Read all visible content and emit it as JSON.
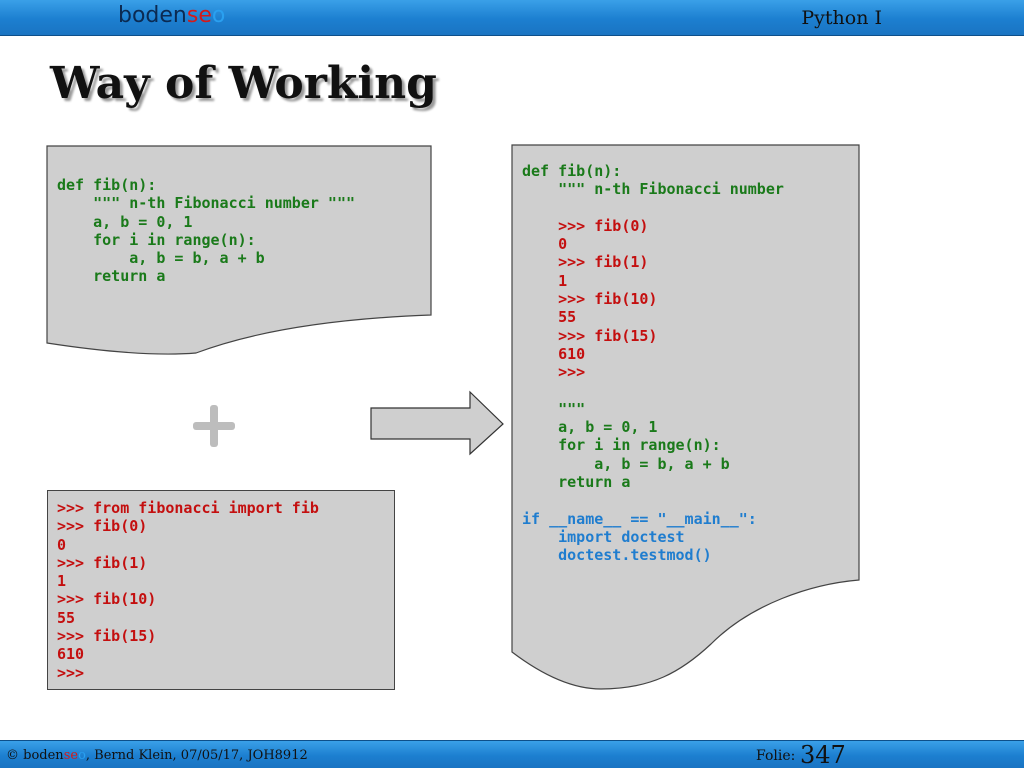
{
  "header": {
    "logo_prefix": "boden",
    "logo_mid": "se",
    "logo_suffix": "o",
    "course": "Python I"
  },
  "title": "Way of Working",
  "left_top_code": [
    {
      "text": "def fib(n):",
      "color": "green"
    },
    {
      "text": "    \"\"\" n-th Fibonacci number \"\"\"",
      "color": "green"
    },
    {
      "text": "    a, b = 0, 1",
      "color": "green"
    },
    {
      "text": "    for i in range(n):",
      "color": "green"
    },
    {
      "text": "        a, b = b, a + b",
      "color": "green"
    },
    {
      "text": "    return a",
      "color": "green"
    }
  ],
  "left_bottom_code": [
    {
      "text": ">>> from fibonacci import fib",
      "color": "red"
    },
    {
      "text": ">>> fib(0)",
      "color": "red"
    },
    {
      "text": "0",
      "color": "red"
    },
    {
      "text": ">>> fib(1)",
      "color": "red"
    },
    {
      "text": "1",
      "color": "red"
    },
    {
      "text": ">>> fib(10)",
      "color": "red"
    },
    {
      "text": "55",
      "color": "red"
    },
    {
      "text": ">>> fib(15)",
      "color": "red"
    },
    {
      "text": "610",
      "color": "red"
    },
    {
      "text": ">>>",
      "color": "red"
    }
  ],
  "right_code": [
    {
      "text": "def fib(n):",
      "color": "green"
    },
    {
      "text": "    \"\"\" n-th Fibonacci number",
      "color": "green"
    },
    {
      "text": "",
      "color": "green"
    },
    {
      "text": "    >>> fib(0)",
      "color": "red"
    },
    {
      "text": "    0",
      "color": "red"
    },
    {
      "text": "    >>> fib(1)",
      "color": "red"
    },
    {
      "text": "    1",
      "color": "red"
    },
    {
      "text": "    >>> fib(10)",
      "color": "red"
    },
    {
      "text": "    55",
      "color": "red"
    },
    {
      "text": "    >>> fib(15)",
      "color": "red"
    },
    {
      "text": "    610",
      "color": "red"
    },
    {
      "text": "    >>>",
      "color": "red"
    },
    {
      "text": "",
      "color": "green"
    },
    {
      "text": "    \"\"\"",
      "color": "green"
    },
    {
      "text": "    a, b = 0, 1",
      "color": "green"
    },
    {
      "text": "    for i in range(n):",
      "color": "green"
    },
    {
      "text": "        a, b = b, a + b",
      "color": "green"
    },
    {
      "text": "    return a",
      "color": "green"
    },
    {
      "text": "",
      "color": "green"
    },
    {
      "text": "if __name__ == \"__main__\":",
      "color": "blue"
    },
    {
      "text": "    import doctest",
      "color": "blue"
    },
    {
      "text": "    doctest.testmod()",
      "color": "blue"
    }
  ],
  "plus_symbol": "+",
  "footer": {
    "copyright": "©",
    "logo_prefix": "boden",
    "logo_mid": "se",
    "logo_suffix": "o",
    "info": ", Bernd Klein, 07/05/17, JOH8912",
    "folie_label": "Folie:",
    "page_number": "347"
  },
  "colors": {
    "green": "#1a7a1a",
    "red": "#c40f0f",
    "blue": "#1f7dcf",
    "box_fill": "#cfcfcf",
    "bar_blue": "#1c7fd0"
  },
  "icons": [
    "plus-icon",
    "right-arrow-icon"
  ]
}
